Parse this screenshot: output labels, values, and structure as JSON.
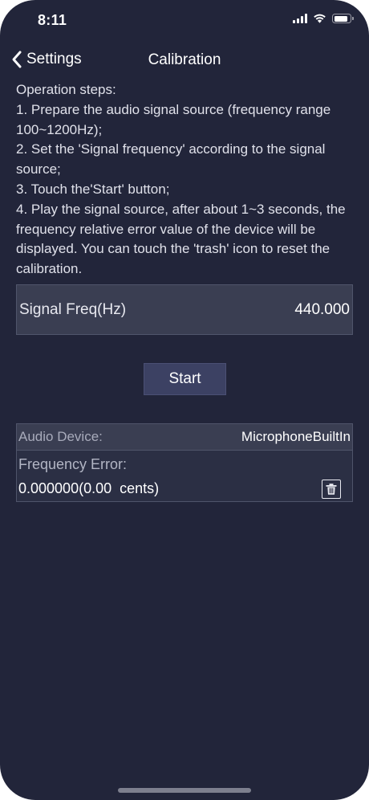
{
  "status_bar": {
    "time": "8:11"
  },
  "nav": {
    "back_label": "Settings",
    "title": "Calibration"
  },
  "instructions": {
    "heading": "Operation steps:",
    "steps": [
      "1. Prepare the audio signal source (frequency range 100~1200Hz);",
      "2. Set the 'Signal frequency' according to the signal source;",
      "3. Touch the'Start' button;",
      "4. Play the signal source, after about 1~3 seconds, the frequency relative error value of the device will be displayed. You can touch the 'trash' icon to reset the calibration."
    ]
  },
  "signal_freq": {
    "label": "Signal Freq(Hz)",
    "value": "440.000"
  },
  "start_button": {
    "label": "Start"
  },
  "result": {
    "audio_device_label": "Audio Device:",
    "audio_device_value": "MicrophoneBuiltIn",
    "error_label": "Frequency Error:",
    "error_value": "0.000000(0.00  cents)"
  },
  "colors": {
    "background": "#22253a",
    "panel": "#3a3e52",
    "button": "#3c4163",
    "text": "#e6e7ee"
  },
  "icons": {
    "back": "chevron-left-icon",
    "trash": "trash-icon",
    "signal": "cellular-signal-icon",
    "wifi": "wifi-icon",
    "battery": "battery-icon"
  }
}
